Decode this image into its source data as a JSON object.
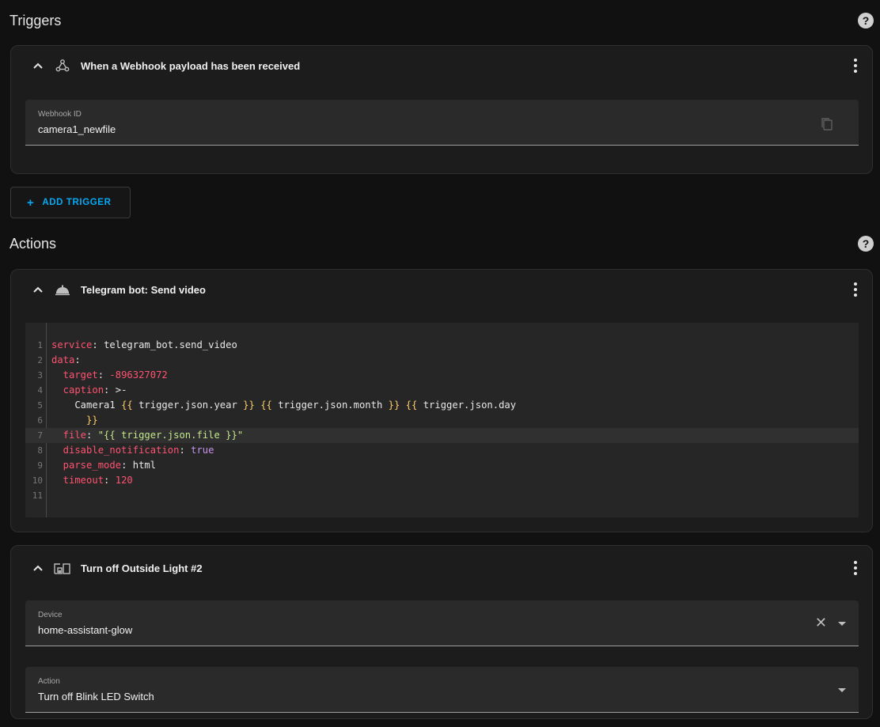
{
  "triggers": {
    "title": "Triggers",
    "help_icon": "help-circle-icon",
    "card": {
      "icon": "webhook-icon",
      "title": "When a Webhook payload has been received",
      "field": {
        "label": "Webhook ID",
        "value": "camera1_newfile",
        "icon": "copy-icon"
      }
    },
    "add_button": {
      "plus": "+",
      "label": "ADD TRIGGER"
    }
  },
  "actions": {
    "title": "Actions",
    "help_icon": "help-circle-icon",
    "telegram": {
      "icon": "bell-icon",
      "title": "Telegram bot: Send video",
      "code_lines": [
        {
          "n": "1",
          "key": "service",
          "sep": ": ",
          "val": "telegram_bot.send_video",
          "val_class": "p"
        },
        {
          "n": "2",
          "key": "data",
          "sep": ":",
          "val": "",
          "val_class": "p"
        },
        {
          "n": "3",
          "key": "  target",
          "sep": ": ",
          "val": "-896327072",
          "val_class": "n"
        },
        {
          "n": "4",
          "key": "  caption",
          "sep": ": ",
          "val": ">-",
          "val_class": "p"
        },
        {
          "n": "5",
          "key": "",
          "sep": "",
          "val": "    Camera1 ",
          "val_class": "p"
        },
        {
          "n": "6",
          "key": "",
          "sep": "",
          "val": "      }}",
          "val_class": "t"
        },
        {
          "n": "7",
          "key": "  file",
          "sep": ": ",
          "val": "\"{{ trigger.json.file }}\"",
          "val_class": "s"
        },
        {
          "n": "8",
          "key": "  disable_notification",
          "sep": ": ",
          "val": "true",
          "val_class": "b"
        },
        {
          "n": "9",
          "key": "  parse_mode",
          "sep": ": ",
          "val": "html",
          "val_class": "p"
        },
        {
          "n": "10",
          "key": "  timeout",
          "sep": ": ",
          "val": "120",
          "val_class": "n"
        },
        {
          "n": "11",
          "key": "",
          "sep": "",
          "val": "",
          "val_class": "p"
        }
      ],
      "line5_parts": [
        {
          "text": "{{",
          "cls": "t"
        },
        {
          "text": " trigger.json.year ",
          "cls": "p"
        },
        {
          "text": "}}",
          "cls": "t"
        },
        {
          "text": " ",
          "cls": "p"
        },
        {
          "text": "{{",
          "cls": "t"
        },
        {
          "text": " trigger.json.month ",
          "cls": "p"
        },
        {
          "text": "}}",
          "cls": "t"
        },
        {
          "text": " ",
          "cls": "p"
        },
        {
          "text": "{{",
          "cls": "t"
        },
        {
          "text": " trigger.json.day",
          "cls": "p"
        }
      ]
    },
    "light": {
      "icon": "device-icon",
      "title": "Turn off Outside Light #2",
      "device": {
        "label": "Device",
        "value": "home-assistant-glow",
        "clear_icon": "close-icon",
        "arrow_icon": "menu-down-icon"
      },
      "action": {
        "label": "Action",
        "value": "Turn off Blink LED Switch",
        "arrow_icon": "menu-down-icon"
      }
    }
  },
  "colors": {
    "accent": "#03a9f4",
    "card_bg": "#1c1c1c",
    "page_bg": "#111111"
  }
}
